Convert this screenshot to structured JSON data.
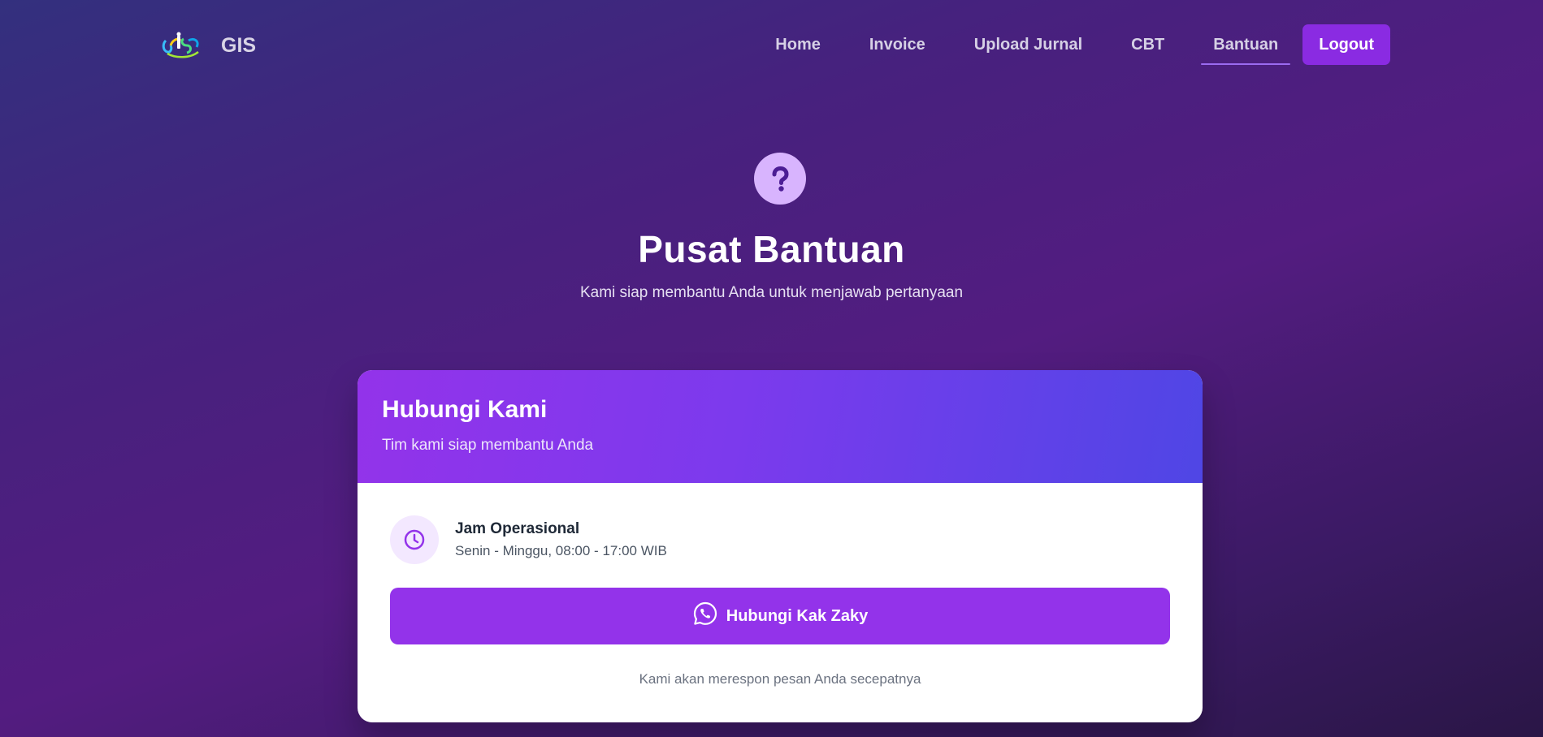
{
  "brand": {
    "name": "GIS",
    "logo_icon": "gis-logo-icon"
  },
  "nav": {
    "items": [
      {
        "label": "Home"
      },
      {
        "label": "Invoice"
      },
      {
        "label": "Upload Jurnal"
      },
      {
        "label": "CBT"
      },
      {
        "label": "Bantuan",
        "active": true
      }
    ],
    "logout_label": "Logout"
  },
  "hero": {
    "icon": "question-circle-icon",
    "title": "Pusat Bantuan",
    "subtitle": "Kami siap membantu Anda untuk menjawab pertanyaan"
  },
  "card": {
    "header_title": "Hubungi Kami",
    "header_subtitle": "Tim kami siap membantu Anda",
    "hours": {
      "icon": "clock-icon",
      "title": "Jam Operasional",
      "value": "Senin - Minggu, 08:00 - 17:00 WIB"
    },
    "contact_button": {
      "icon": "whatsapp-icon",
      "label": "Hubungi Kak Zaky"
    },
    "note": "Kami akan merespon pesan Anda secepatnya"
  },
  "colors": {
    "accent": "#9333ea",
    "logout": "#8a2be2",
    "header_gradient_start": "#9333ea",
    "header_gradient_end": "#4f46e5",
    "hero_icon_bg": "#d8b4fe"
  }
}
